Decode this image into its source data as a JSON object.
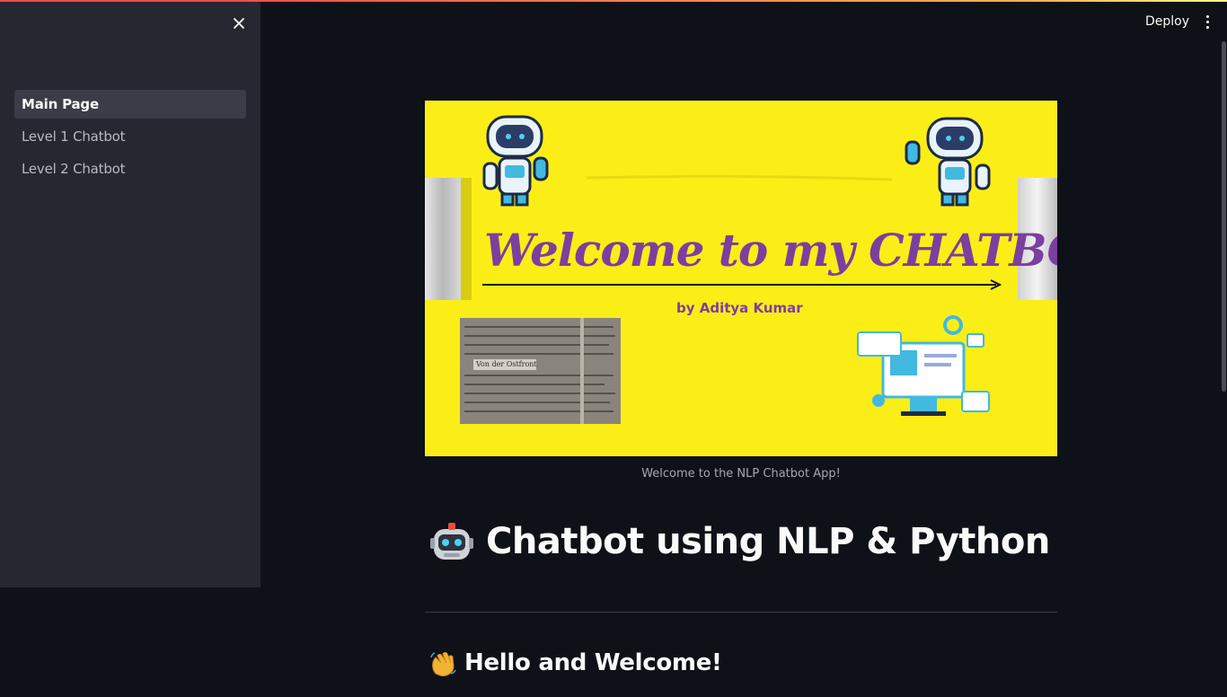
{
  "header": {
    "deploy_label": "Deploy",
    "menu_icon": "kebab-menu-icon"
  },
  "sidebar": {
    "close_icon": "close-icon",
    "items": [
      {
        "label": "Main Page",
        "active": true
      },
      {
        "label": "Level 1 Chatbot",
        "active": false
      },
      {
        "label": "Level 2 Chatbot",
        "active": false
      }
    ]
  },
  "banner": {
    "headline": "Welcome to my CHATBOT",
    "byline": "by Aditya Kumar",
    "newspaper_text": "Von der Ostfront",
    "background_color": "#fbee16",
    "headline_color": "#7b3fa0"
  },
  "main": {
    "caption": "Welcome to the NLP Chatbot App!",
    "title": "Chatbot using NLP & Python",
    "title_icon": "robot-emoji",
    "subheading": "Hello and Welcome!",
    "subheading_icon": "waving-hand-emoji"
  },
  "colors": {
    "app_background": "#0e1117",
    "sidebar_background": "#262730",
    "accent": "#ff4b4b"
  }
}
